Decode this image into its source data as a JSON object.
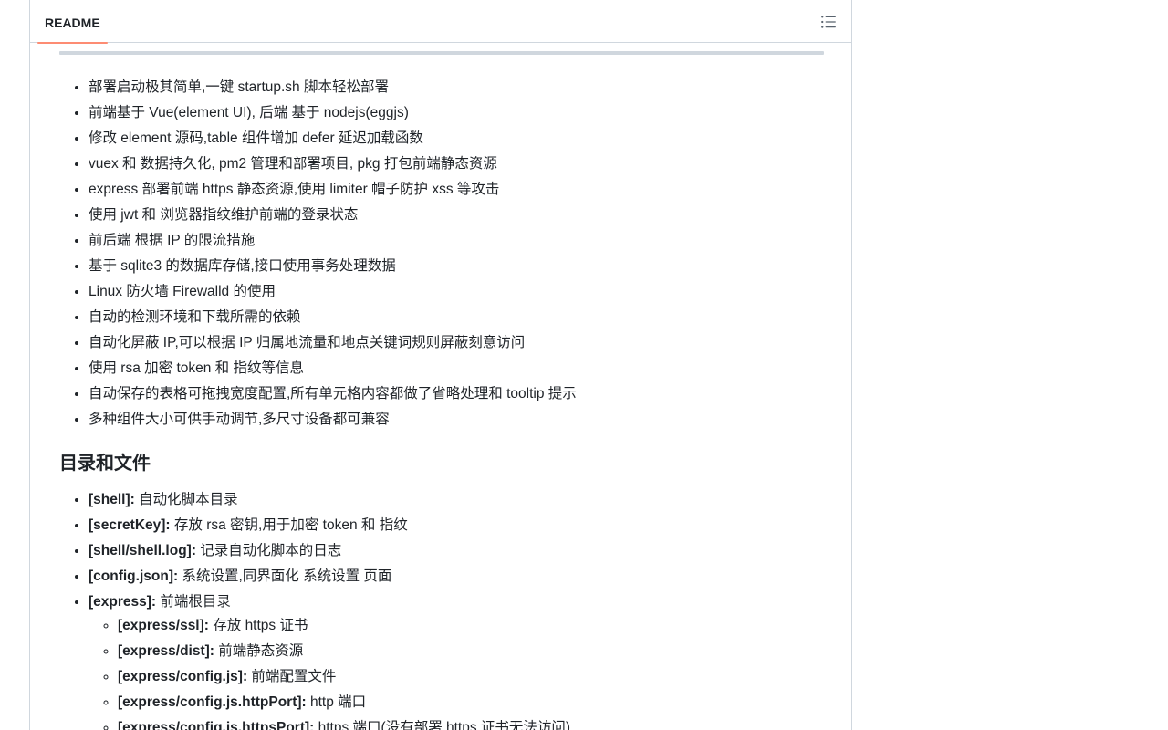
{
  "header": {
    "tab_label": "README",
    "outline_icon": "list-unordered-icon"
  },
  "features": [
    "部署启动极其简单,一键 startup.sh 脚本轻松部署",
    "前端基于 Vue(element UI), 后端 基于 nodejs(eggjs)",
    "修改 element 源码,table 组件增加 defer 延迟加载函数",
    "vuex 和 数据持久化, pm2 管理和部署项目, pkg 打包前端静态资源",
    "express 部署前端 https 静态资源,使用 limiter 帽子防护 xss 等攻击",
    "使用 jwt 和 浏览器指纹维护前端的登录状态",
    "前后端 根据 IP 的限流措施",
    "基于 sqlite3 的数据库存储,接口使用事务处理数据",
    "Linux 防火墙 Firewalld 的使用",
    "自动的检测环境和下载所需的依赖",
    "自动化屏蔽 IP,可以根据 IP 归属地流量和地点关键词规则屏蔽刻意访问",
    "使用 rsa 加密 token 和 指纹等信息",
    "自动保存的表格可拖拽宽度配置,所有单元格内容都做了省略处理和 tooltip 提示",
    "多种组件大小可供手动调节,多尺寸设备都可兼容"
  ],
  "dirs_section": {
    "title": "目录和文件",
    "items": [
      {
        "key": "[shell]:",
        "desc": " 自动化脚本目录"
      },
      {
        "key": "[secretKey]:",
        "desc": " 存放 rsa 密钥,用于加密 token 和 指纹"
      },
      {
        "key": "[shell/shell.log]:",
        "desc": " 记录自动化脚本的日志"
      },
      {
        "key": "[config.json]:",
        "desc": " 系统设置,同界面化 系统设置 页面"
      },
      {
        "key": "[express]:",
        "desc": " 前端根目录"
      }
    ],
    "express_children": [
      {
        "key": "[express/ssl]:",
        "desc": " 存放 https 证书"
      },
      {
        "key": "[express/dist]:",
        "desc": " 前端静态资源"
      },
      {
        "key": "[express/config.js]:",
        "desc": " 前端配置文件"
      },
      {
        "key": "[express/config.js.httpPort]:",
        "desc": " http 端口"
      },
      {
        "key": "[express/config.js.httpsPort]:",
        "desc": " https 端口(没有部署 https 证书无法访问)"
      }
    ]
  }
}
